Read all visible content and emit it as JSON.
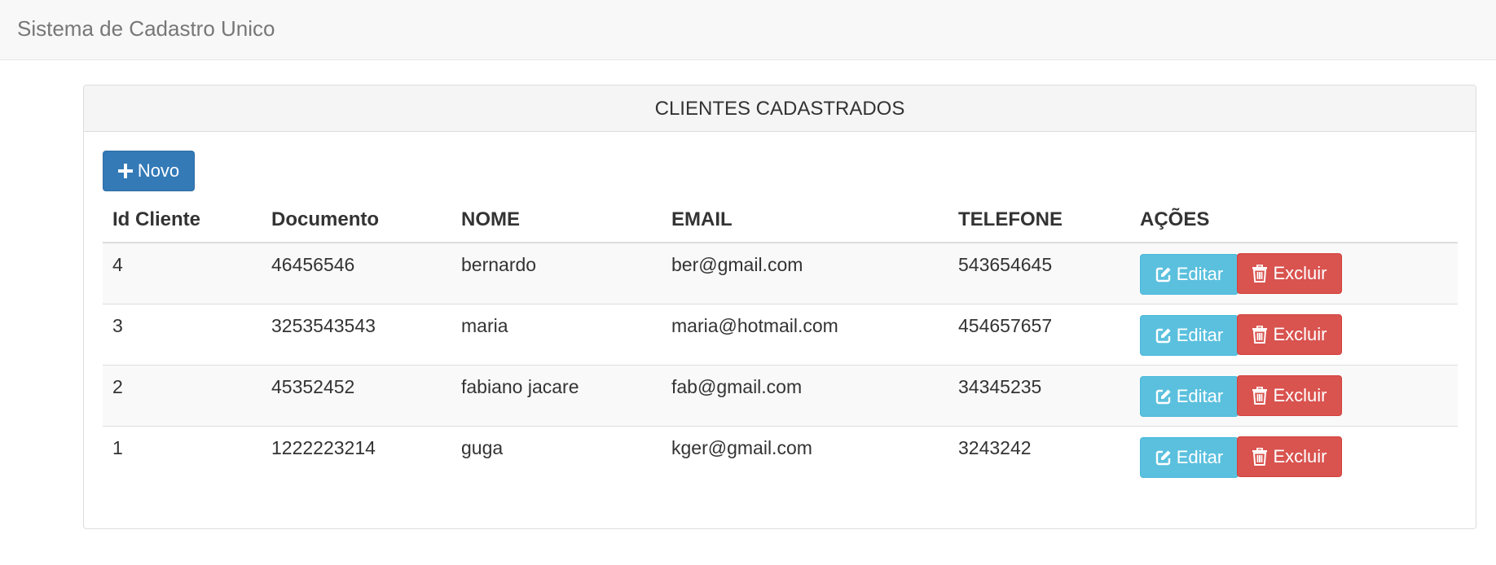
{
  "navbar": {
    "brand": "Sistema de Cadastro Unico"
  },
  "panel": {
    "title": "CLIENTES CADASTRADOS",
    "new_button": {
      "icon": "plus-icon",
      "label": "Novo"
    }
  },
  "table": {
    "headers": [
      "Id Cliente",
      "Documento",
      "NOME",
      "EMAIL",
      "TELEFONE",
      "AÇÕES"
    ],
    "rows": [
      {
        "id": "4",
        "documento": "46456546",
        "nome": "bernardo",
        "email": "ber@gmail.com",
        "telefone": "543654645"
      },
      {
        "id": "3",
        "documento": "3253543543",
        "nome": "maria",
        "email": "maria@hotmail.com",
        "telefone": "454657657"
      },
      {
        "id": "2",
        "documento": "45352452",
        "nome": "fabiano jacare",
        "email": "fab@gmail.com",
        "telefone": "34345235"
      },
      {
        "id": "1",
        "documento": "1222223214",
        "nome": "guga",
        "email": "kger@gmail.com",
        "telefone": "3243242"
      }
    ],
    "actions": {
      "edit_label": "Editar",
      "edit_icon": "edit-icon",
      "delete_label": "Excluir",
      "delete_icon": "trash-icon"
    }
  },
  "colors": {
    "primary": "#337ab7",
    "info": "#5bc0de",
    "danger": "#d9534f",
    "navbar_bg": "#f8f8f8"
  }
}
